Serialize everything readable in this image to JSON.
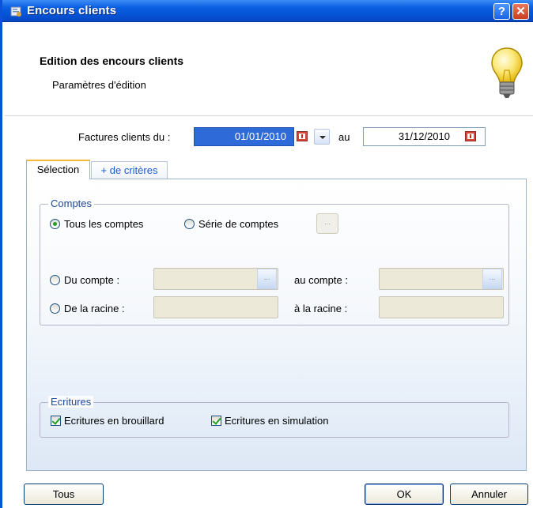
{
  "window": {
    "title": "Encours clients"
  },
  "header": {
    "title": "Edition des encours clients",
    "subtitle": "Paramètres d'édition"
  },
  "dates": {
    "label": "Factures clients du :",
    "from": "01/01/2010",
    "to_label": "au",
    "to": "31/12/2010"
  },
  "tabs": [
    {
      "label": "Sélection",
      "selected": true
    },
    {
      "label": "+ de critères",
      "selected": false
    }
  ],
  "comptes": {
    "legend": "Comptes",
    "opt_all": "Tous les comptes",
    "opt_series": "Série de comptes",
    "series_btn": "...",
    "opt_du_compte": "Du compte :",
    "au_compte": "au compte :",
    "opt_racine": "De la racine :",
    "a_racine": "à la racine :",
    "lookup_btn": "..."
  },
  "ecritures": {
    "legend": "Ecritures",
    "brouillard": "Ecritures en brouillard",
    "simulation": "Ecritures en simulation"
  },
  "buttons": {
    "tous": "Tous",
    "ok": "OK",
    "annuler": "Annuler"
  },
  "colors": {
    "titlebar": "#0553d6",
    "selected_field": "#2f6ad9",
    "accent_tab": "#f4b93a"
  }
}
